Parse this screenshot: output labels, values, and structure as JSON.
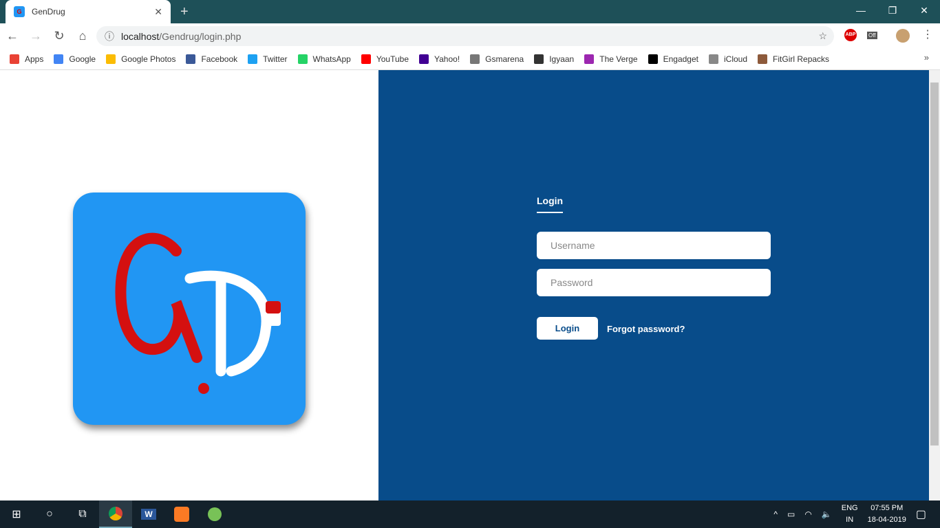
{
  "browser": {
    "tab_title": "GenDrug",
    "url_host": "localhost",
    "url_path": "/Gendrug/login.php",
    "bookmarks": [
      {
        "label": "Apps",
        "color": "#e94235"
      },
      {
        "label": "Google",
        "color": "#4285f4"
      },
      {
        "label": "Google Photos",
        "color": "#fbbc04"
      },
      {
        "label": "Facebook",
        "color": "#3b5998"
      },
      {
        "label": "Twitter",
        "color": "#1da1f2"
      },
      {
        "label": "WhatsApp",
        "color": "#25d366"
      },
      {
        "label": "YouTube",
        "color": "#ff0000"
      },
      {
        "label": "Yahoo!",
        "color": "#410093"
      },
      {
        "label": "Gsmarena",
        "color": "#777777"
      },
      {
        "label": "Igyaan",
        "color": "#333333"
      },
      {
        "label": "The Verge",
        "color": "#9c27b0"
      },
      {
        "label": "Engadget",
        "color": "#000000"
      },
      {
        "label": "iCloud",
        "color": "#888888"
      },
      {
        "label": "FitGirl Repacks",
        "color": "#8d5a3b"
      }
    ],
    "ext_abp": "ABP",
    "ext_off": "Off"
  },
  "login": {
    "heading": "Login",
    "username_placeholder": "Username",
    "password_placeholder": "Password",
    "button": "Login",
    "forgot": "Forgot password?"
  },
  "colors": {
    "panel": "#084c8a",
    "logo_bg": "#2196f3"
  },
  "taskbar": {
    "lang1": "ENG",
    "lang2": "IN",
    "time": "07:55 PM",
    "date": "18-04-2019"
  }
}
